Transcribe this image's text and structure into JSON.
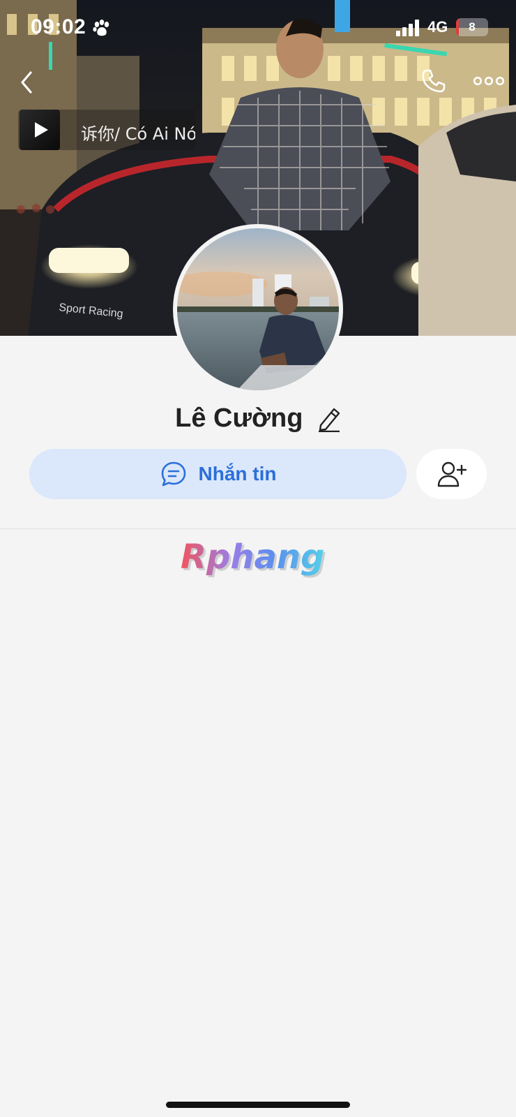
{
  "status_bar": {
    "time": "09:02",
    "network": "4G",
    "battery": "8",
    "battery_level_percent": 8
  },
  "header": {
    "back_icon": "chevron-left-icon",
    "call_icon": "phone-icon",
    "more_icon": "more-horizontal-icon"
  },
  "music": {
    "title": "诉你/ Có Ai Nó",
    "play_icon": "play-icon"
  },
  "profile": {
    "name": "Lê Cường",
    "edit_icon": "pencil-icon"
  },
  "actions": {
    "message_label": "Nhắn tin",
    "message_icon": "chat-bubble-icon",
    "add_friend_icon": "add-user-icon"
  },
  "watermark": {
    "text": "Rphang"
  },
  "colors": {
    "background": "#f4f4f4",
    "message_button_bg": "#dbe7fb",
    "accent_blue": "#2b6fd9",
    "battery_low": "#e23b3b"
  }
}
